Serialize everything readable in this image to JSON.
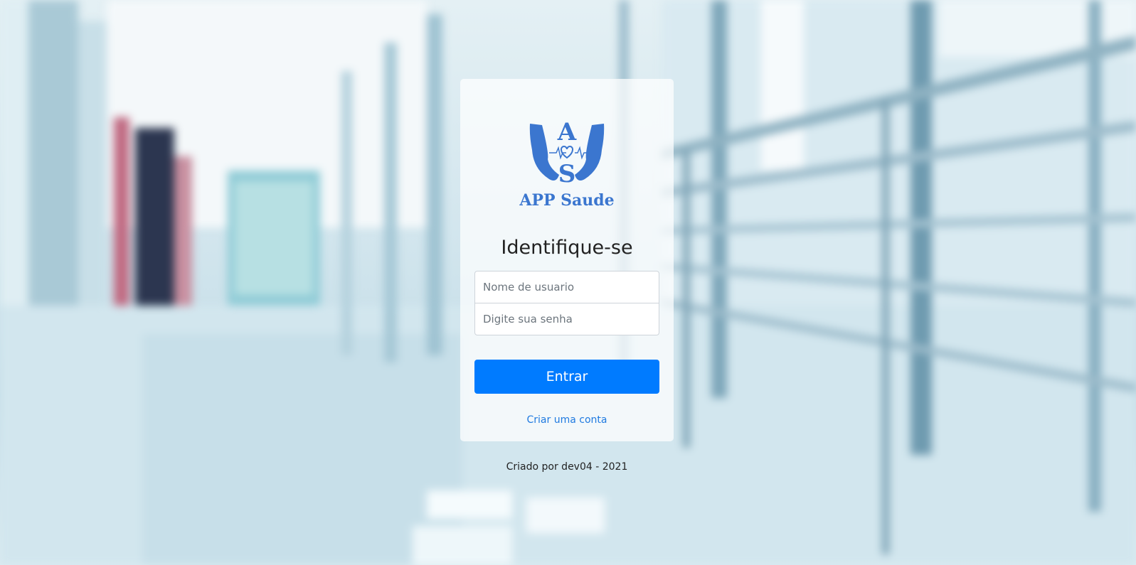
{
  "brand": {
    "logo_letters": "AS",
    "name": "APP Saude"
  },
  "login": {
    "heading": "Identifique-se",
    "username_placeholder": "Nome de usuario",
    "password_placeholder": "Digite sua senha",
    "submit_label": "Entrar",
    "signup_link": "Criar uma conta"
  },
  "footer": {
    "credit": "Criado por dev04 - 2021"
  },
  "colors": {
    "brand": "#3b76cf",
    "primary": "#007bff",
    "link": "#1f7ae0"
  },
  "icons": {
    "logo": "hands-heart-heartbeat-logo"
  }
}
